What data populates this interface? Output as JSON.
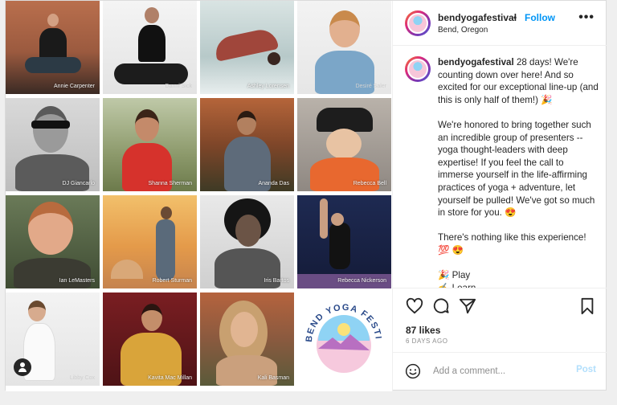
{
  "account": {
    "username": "bendyogafestival",
    "separator": "•",
    "follow_label": "Follow",
    "location": "Bend, Oregon",
    "more_label": "•••"
  },
  "photos": [
    {
      "name": "Annie Carpenter"
    },
    {
      "name": "Danni Sick"
    },
    {
      "name": "Ashley Lorensen"
    },
    {
      "name": "Desiré Saler"
    },
    {
      "name": "DJ Giancarlo"
    },
    {
      "name": "Shanna Sherman"
    },
    {
      "name": "Ananda Das"
    },
    {
      "name": "Rebecca Bell"
    },
    {
      "name": "Ian LeMasters"
    },
    {
      "name": "Robert Sturman"
    },
    {
      "name": "Iris Bartos"
    },
    {
      "name": "Rebecca Nickerson"
    },
    {
      "name": "Libby Cox"
    },
    {
      "name": "Kavita Mac Millan"
    },
    {
      "name": "Kali Basman"
    },
    {
      "name": "BEND YOGA FESTIVAL"
    }
  ],
  "caption": {
    "username": "bendyogafestival",
    "text": " 28 days! We're counting down over here! And so excited for our exceptional line-up (and this is only half of them!) 🎉\n\nWe're honored to bring together such an incredible group of presenters -- yoga thought-leaders with deep expertise! If you feel the call to immerse yourself in the life-affirming practices of yoga + adventure, let yourself be pulled! We've got so much in store for you. 😍\n\nThere's nothing like this experience! 💯 😍\n\n🎉 Play\n✍️ Learn"
  },
  "stats": {
    "likes": "87 likes",
    "date": "6 DAYS AGO"
  },
  "comment_box": {
    "placeholder": "Add a comment...",
    "post_label": "Post"
  },
  "icons": [
    "heart-icon",
    "comment-icon",
    "share-icon",
    "bookmark-icon",
    "emoji-icon",
    "user-tag-icon",
    "more-options-icon"
  ],
  "colors": {
    "link_blue": "#0095f6",
    "post_disabled": "#b2dffc",
    "muted": "#8e8e8e",
    "border": "#dbdbdb"
  }
}
